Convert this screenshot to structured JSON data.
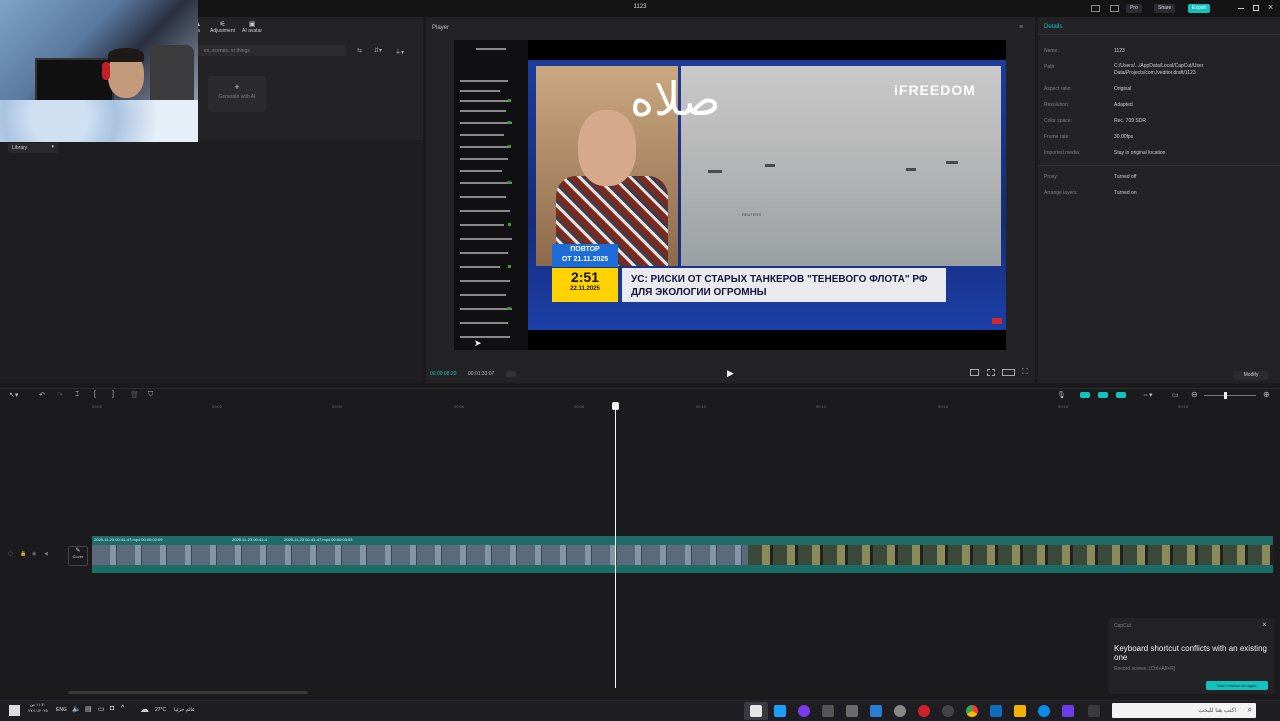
{
  "app": {
    "project_title": "1123",
    "pro_label": "Pro",
    "share_label": "Share",
    "export_label": "Export"
  },
  "media_panel": {
    "tabs": [
      {
        "label": "rs"
      },
      {
        "label": "Adjustment"
      },
      {
        "label": "AI avatar"
      }
    ],
    "search_placeholder": "es, scenes, or things",
    "generate_label": "Generate with AI",
    "library_label": "Library"
  },
  "player": {
    "title": "Player",
    "current_time": "00:00:08:20",
    "total_time": "00:01:33:07",
    "video": {
      "arabic_overlay": "صلاه",
      "logo": "iFREEDOM",
      "repeat_line1": "ПОВТОР",
      "repeat_line2": "ОТ 21.11.2025",
      "clock": "2:51",
      "date": "22.11.2025",
      "headline": "УС: РИСКИ ОТ СТАРЫХ ТАНКЕРОВ \"ТЕНЕВОГО ФЛОТА\" РФ ДЛЯ ЭКОЛОГИИ ОГРОМНЫ",
      "watermark": "REUTERS"
    }
  },
  "details": {
    "title": "Details",
    "rows": [
      {
        "label": "Name:",
        "value": "1123"
      },
      {
        "label": "Path:",
        "value": "C:/Users/.../AppData/Local/CapCut/User Data/Projects/com.lveditor.draft/1123"
      },
      {
        "label": "Aspect ratio:",
        "value": "Original"
      },
      {
        "label": "Resolution:",
        "value": "Adapted"
      },
      {
        "label": "Color space:",
        "value": "Rec. 709 SDR"
      },
      {
        "label": "Frame rate:",
        "value": "30.00fps"
      },
      {
        "label": "Imported media:",
        "value": "Stay in original location"
      },
      {
        "label": "Proxy:",
        "value": "Turned off"
      },
      {
        "label": "Arrange layers:",
        "value": "Turned on"
      }
    ],
    "modify_label": "Modify"
  },
  "timeline": {
    "ruler_ticks": [
      "00:00",
      "00:02",
      "00:04",
      "00:06",
      "00:08",
      "00:10",
      "00:12",
      "00:14",
      "00:16",
      "00:18"
    ],
    "clip_labels": [
      "2025-11-23 00-41-47.mp4  00:00:02:09",
      "2025-11-23 00-41-4",
      "2025-11-23 00-41-47.mp4  00:00:03:03"
    ],
    "cover_label": "Cover"
  },
  "toast": {
    "app": "CapCut",
    "title": "Keyboard shortcut conflicts with an existing one",
    "subtitle": "Record screen: [Ctrl+Alt+R]",
    "button_label": "Don't remind me again"
  },
  "taskbar": {
    "time": "١١:٣٠ ص",
    "date": "٢٧/١١/٢٠٢٥",
    "language": "ENG",
    "weather": "27°C",
    "weather_text": "عالم جزئيا",
    "search_placeholder": "اكتب هنا للبحث"
  },
  "colors": {
    "accent": "#14c1bd",
    "background": "#1b1b1d",
    "panel": "#232325"
  }
}
